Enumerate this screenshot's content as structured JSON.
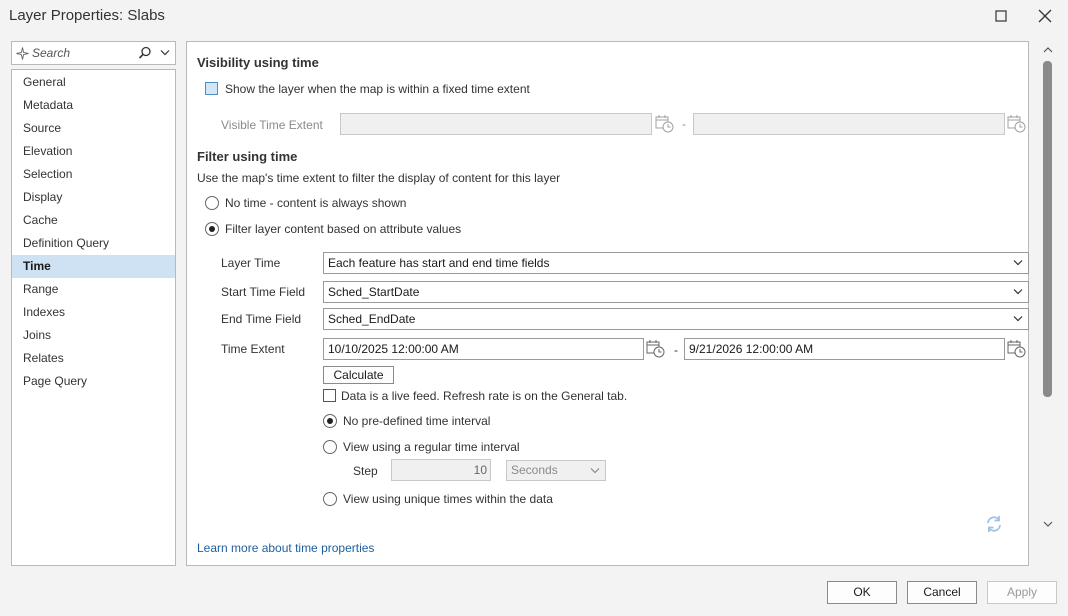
{
  "window": {
    "title": "Layer Properties: Slabs"
  },
  "search": {
    "placeholder": "Search"
  },
  "nav": {
    "items": [
      "General",
      "Metadata",
      "Source",
      "Elevation",
      "Selection",
      "Display",
      "Cache",
      "Definition Query",
      "Time",
      "Range",
      "Indexes",
      "Joins",
      "Relates",
      "Page Query"
    ],
    "selected": "Time"
  },
  "visibility": {
    "heading": "Visibility using time",
    "checkbox_label": "Show the layer when the map is within a fixed time extent",
    "checked": false,
    "extent_label": "Visible Time Extent",
    "separator": "-"
  },
  "filter": {
    "heading": "Filter using time",
    "description": "Use the map's time extent to filter the display of content for this layer",
    "option_none": "No time - content is always shown",
    "option_attribute": "Filter layer content based on attribute values",
    "selected_option": "attribute",
    "layer_time_label": "Layer Time",
    "layer_time_value": "Each feature has start and end time fields",
    "start_field_label": "Start Time Field",
    "start_field_value": "Sched_StartDate",
    "end_field_label": "End Time Field",
    "end_field_value": "Sched_EndDate",
    "time_extent_label": "Time Extent",
    "time_extent_start": "10/10/2025 12:00:00 AM",
    "time_extent_end": "9/21/2026 12:00:00 AM",
    "separator": "-",
    "calculate_label": "Calculate",
    "live_feed_label": "Data is a live feed. Refresh rate is on the General tab.",
    "live_feed_checked": false,
    "interval_none": "No pre-defined time interval",
    "interval_regular": "View using a regular time interval",
    "interval_unique": "View using unique times within the data",
    "selected_interval": "none",
    "step_label": "Step",
    "step_value": "10",
    "step_unit": "Seconds"
  },
  "footer": {
    "learn_more": "Learn more about time properties",
    "ok": "OK",
    "cancel": "Cancel",
    "apply": "Apply"
  },
  "colors": {
    "selected_nav": "#cfe2f3",
    "link": "#1f5fa0",
    "accent": "#4a90c8"
  }
}
